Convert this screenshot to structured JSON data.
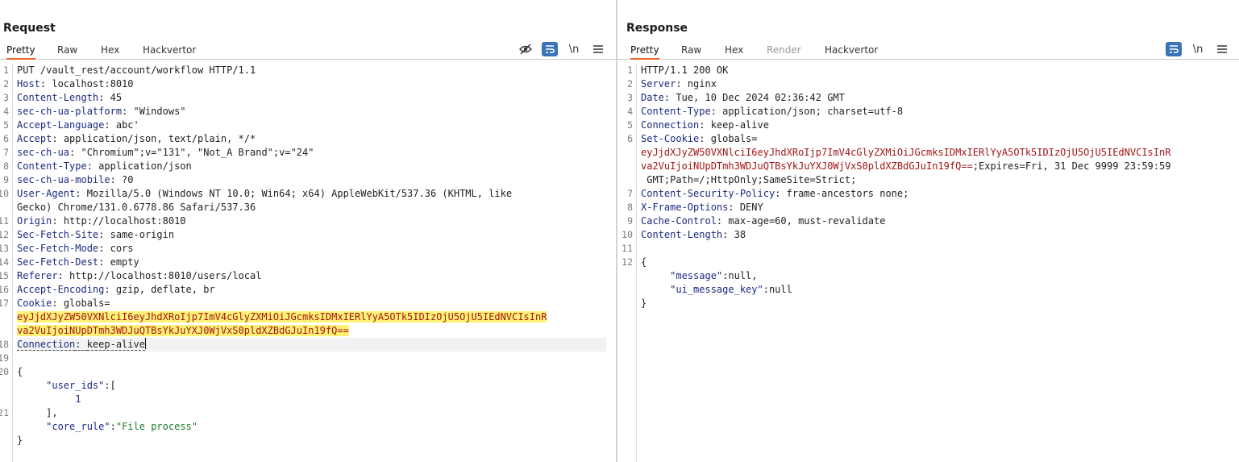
{
  "request": {
    "title": "Request",
    "tabs": [
      "Pretty",
      "Raw",
      "Hex",
      "Hackvertor"
    ],
    "active_tab": "Pretty",
    "toolbar": {
      "wrap_label": "\\n"
    },
    "line_numbers": [
      "1",
      "2",
      "3",
      "4",
      "5",
      "6",
      "7",
      "8",
      "9",
      "10",
      "11",
      "12",
      "13",
      "14",
      "15",
      "16",
      "17",
      "18",
      "19",
      "20",
      "21"
    ],
    "request_line": "PUT /vault_rest/account/workflow HTTP/1.1",
    "headers": [
      {
        "name": "Host",
        "value": "localhost:8010"
      },
      {
        "name": "Content-Length",
        "value": "45"
      },
      {
        "name": "sec-ch-ua-platform",
        "value": "\"Windows\""
      },
      {
        "name": "Accept-Language",
        "value": "abc'"
      },
      {
        "name": "Accept",
        "value": "application/json, text/plain, */*"
      },
      {
        "name": "sec-ch-ua",
        "value": "\"Chromium\";v=\"131\", \"Not_A Brand\";v=\"24\""
      },
      {
        "name": "Content-Type",
        "value": "application/json"
      },
      {
        "name": "sec-ch-ua-mobile",
        "value": "?0"
      },
      {
        "name": "User-Agent",
        "value": "Mozilla/5.0 (Windows NT 10.0; Win64; x64) AppleWebKit/537.36 (KHTML, like"
      },
      {
        "name": "",
        "value": "Gecko) Chrome/131.0.6778.86 Safari/537.36"
      },
      {
        "name": "Origin",
        "value": "http://localhost:8010"
      },
      {
        "name": "Sec-Fetch-Site",
        "value": "same-origin"
      },
      {
        "name": "Sec-Fetch-Mode",
        "value": "cors"
      },
      {
        "name": "Sec-Fetch-Dest",
        "value": "empty"
      },
      {
        "name": "Referer",
        "value": "http://localhost:8010/users/local"
      },
      {
        "name": "Accept-Encoding",
        "value": "gzip, deflate, br"
      },
      {
        "name": "Cookie",
        "value": "globals="
      }
    ],
    "cookie_value_1": "eyJjdXJyZW50VXNlciI6eyJhdXRoIjp7ImV4cGlyZXMiOiJGcmksIDMxIERlYyA5OTk5IDIzOjU5OjU5IEdNVCIsInR",
    "cookie_value_2": "va2VuIjoiNUpDTmh3WDJuQTBsYkJuYXJ0WjVxS0pldXZBdGJuIn19fQ==",
    "connection": {
      "name": "Connection",
      "value": "keep-alive"
    },
    "body": {
      "open": "{",
      "key1": "\"user_ids\"",
      "colon1": ":[",
      "val1": "1",
      "close_arr": "],",
      "key2": "\"core_rule\"",
      "colon2": ":",
      "val2": "\"File process\"",
      "close": "}"
    }
  },
  "response": {
    "title": "Response",
    "tabs": [
      "Pretty",
      "Raw",
      "Hex",
      "Render",
      "Hackvertor"
    ],
    "active_tab": "Pretty",
    "toolbar": {
      "wrap_label": "\\n"
    },
    "line_numbers": [
      "1",
      "2",
      "3",
      "4",
      "5",
      "6",
      "7",
      "8",
      "9",
      "10",
      "11",
      "12"
    ],
    "status_line": "HTTP/1.1 200 OK",
    "headers": [
      {
        "name": "Server",
        "value": "nginx"
      },
      {
        "name": "Date",
        "value": "Tue, 10 Dec 2024 02:36:42 GMT"
      },
      {
        "name": "Content-Type",
        "value": "application/json; charset=utf-8"
      },
      {
        "name": "Connection",
        "value": "keep-alive"
      },
      {
        "name": "Set-Cookie",
        "value": "globals="
      }
    ],
    "set_cookie_1": "eyJjdXJyZW50VXNlciI6eyJhdXRoIjp7ImV4cGlyZXMiOiJGcmksIDMxIERlYyA5OTk5IDIzOjU5OjU5IEdNVCIsInR",
    "set_cookie_2a": "va2VuIjoiNUpDTmh3WDJuQTBsYkJuYXJ0WjVxS0pldXZBdGJuIn19fQ==",
    "set_cookie_2b": ";Expires=Fri, 31 Dec 9999 23:59:59",
    "set_cookie_3": " GMT;Path=/;HttpOnly;SameSite=Strict;",
    "headers2": [
      {
        "name": "Content-Security-Policy",
        "value": "frame-ancestors none;"
      },
      {
        "name": "X-Frame-Options",
        "value": "DENY"
      },
      {
        "name": "Cache-Control",
        "value": "max-age=60, must-revalidate"
      },
      {
        "name": "Content-Length",
        "value": "38"
      }
    ],
    "body": {
      "open": "{",
      "key1": "\"message\"",
      "val1": ":null,",
      "key2": "\"ui_message_key\"",
      "val2": ":null",
      "close": "}"
    }
  }
}
